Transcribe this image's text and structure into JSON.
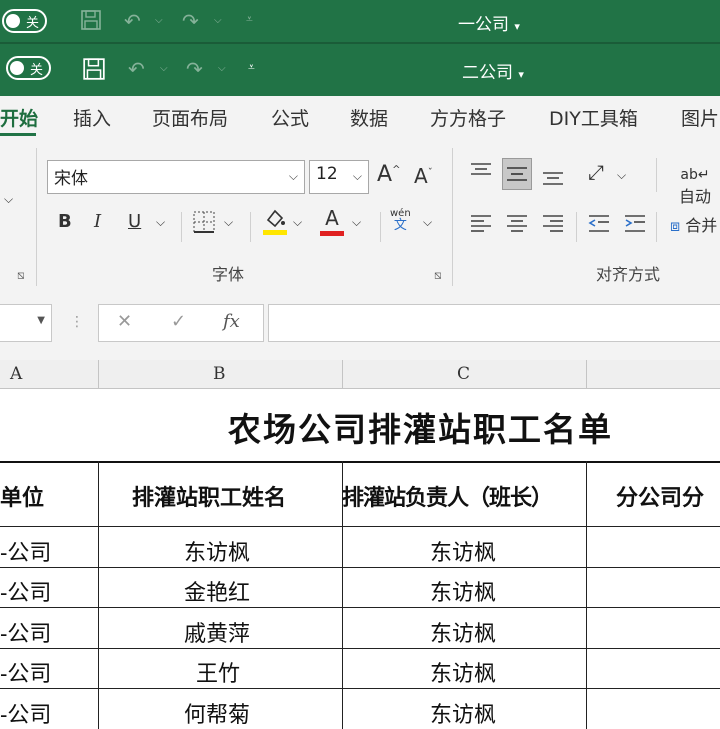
{
  "window1": {
    "toggle_label": "关",
    "doc_title": "一公司"
  },
  "window2": {
    "toggle_label": "关",
    "doc_title": "二公司"
  },
  "ribbon_tabs": [
    "开始",
    "插入",
    "页面布局",
    "公式",
    "数据",
    "方方格子",
    "DIY工具箱",
    "图片"
  ],
  "font": {
    "name": "宋体",
    "size": "12"
  },
  "font_buttons": {
    "grow": "A",
    "shrink": "A",
    "bold": "B",
    "italic": "I",
    "underline": "U",
    "font_color": "A",
    "phonetic_top": "wén",
    "phonetic_bottom": "文"
  },
  "wrap_label": "自动",
  "merge_label": "合并",
  "group_labels": {
    "font": "字体",
    "alignment": "对齐方式"
  },
  "formula_bar": {
    "fx": "fx",
    "cancel": "✕",
    "enter": "✓"
  },
  "columns": [
    "A",
    "B",
    "C"
  ],
  "sheet": {
    "title": "农场公司排灌站职工名单",
    "headers": [
      "单位",
      "排灌站职工姓名",
      "排灌站负责人（班长）",
      "分公司分"
    ],
    "rows": [
      [
        "-公司",
        "东访枫",
        "东访枫"
      ],
      [
        "-公司",
        "金艳红",
        "东访枫"
      ],
      [
        "-公司",
        "戚黄萍",
        "东访枫"
      ],
      [
        "-公司",
        "王竹",
        "东访枫"
      ],
      [
        "-公司",
        "何帮菊",
        "东访枫"
      ]
    ]
  },
  "colors": {
    "excel_green": "#217346",
    "highlight_yellow": "#ffe600",
    "font_red": "#e02020"
  }
}
